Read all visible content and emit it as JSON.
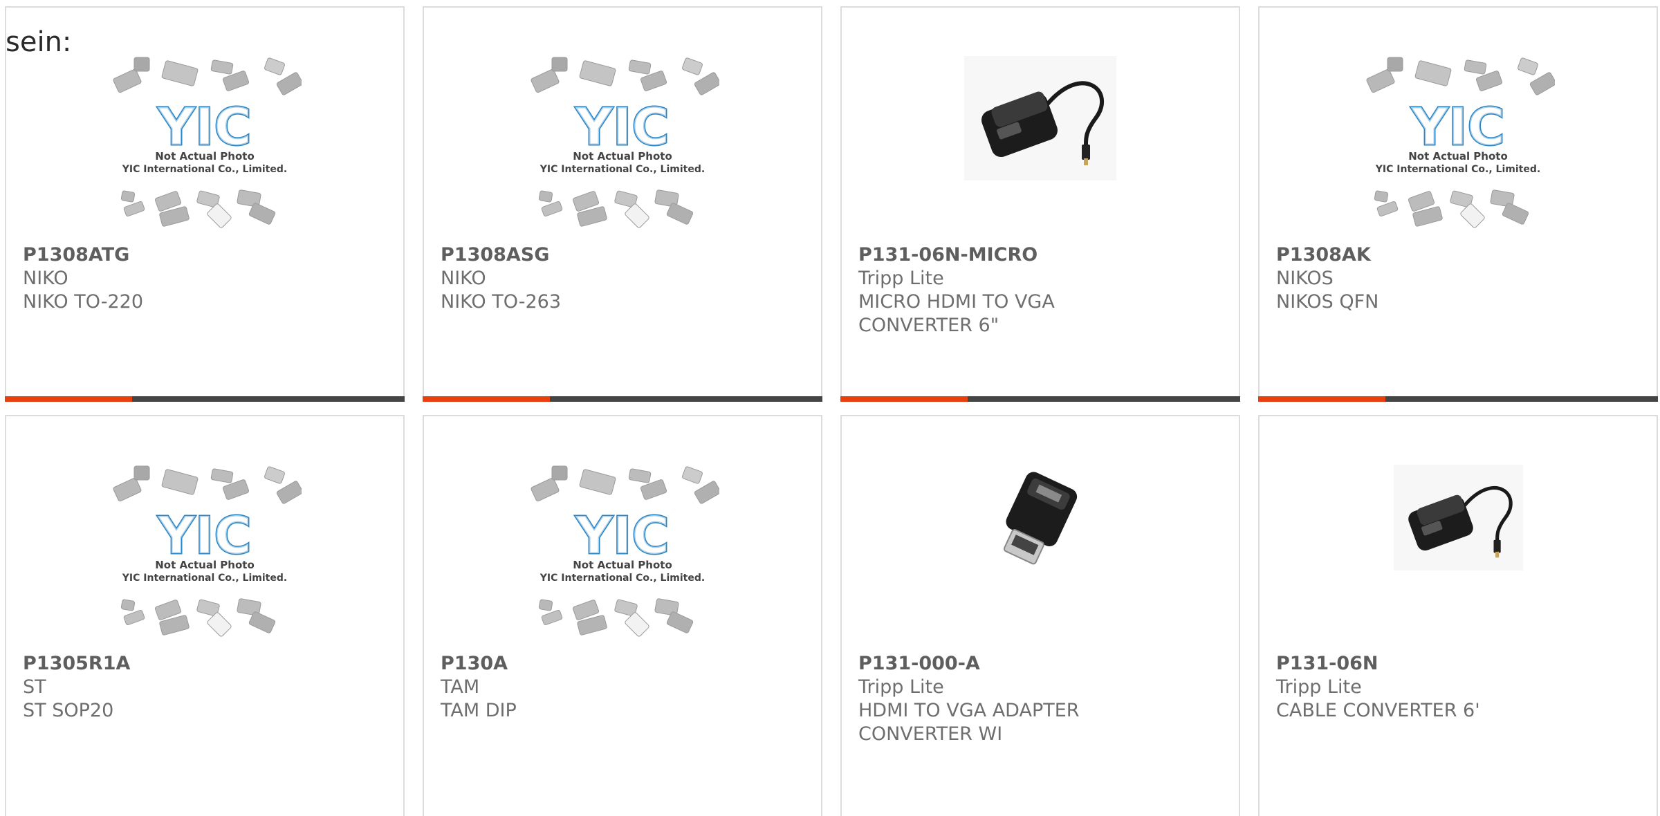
{
  "overflow_text": "sein:",
  "colors": {
    "accent": "#e8400c",
    "bar_dark": "#444444",
    "card_border": "#dcdcdc",
    "yic_blue": "#2b86c5"
  },
  "placeholder_image": {
    "caption_line1": "Not Actual Photo",
    "caption_line2": "YIC International Co., Limited.",
    "logo_text": "YIC"
  },
  "products": [
    {
      "part_no": "P1308ATG",
      "brand": "NIKO",
      "desc": "NIKO TO-220",
      "image": "yic-placeholder"
    },
    {
      "part_no": "P1308ASG",
      "brand": "NIKO",
      "desc": "NIKO TO-263",
      "image": "yic-placeholder"
    },
    {
      "part_no": "P131-06N-MICRO",
      "brand": "Tripp Lite",
      "desc": "MICRO HDMI TO VGA CONVERTER 6\"",
      "image": "hdmi-vga-cable-adapter"
    },
    {
      "part_no": "P1308AK",
      "brand": "NIKOS",
      "desc": "NIKOS QFN",
      "image": "yic-placeholder"
    },
    {
      "part_no": "P1305R1A",
      "brand": "ST",
      "desc": "ST SOP20",
      "image": "yic-placeholder"
    },
    {
      "part_no": "P130A",
      "brand": "TAM",
      "desc": "TAM DIP",
      "image": "yic-placeholder"
    },
    {
      "part_no": "P131-000-A",
      "brand": "Tripp Lite",
      "desc": "HDMI TO VGA ADAPTER CONVERTER WI",
      "image": "hdmi-vga-dongle"
    },
    {
      "part_no": "P131-06N",
      "brand": "Tripp Lite",
      "desc": "CABLE CONVERTER 6'",
      "image": "hdmi-vga-cable-adapter"
    }
  ]
}
